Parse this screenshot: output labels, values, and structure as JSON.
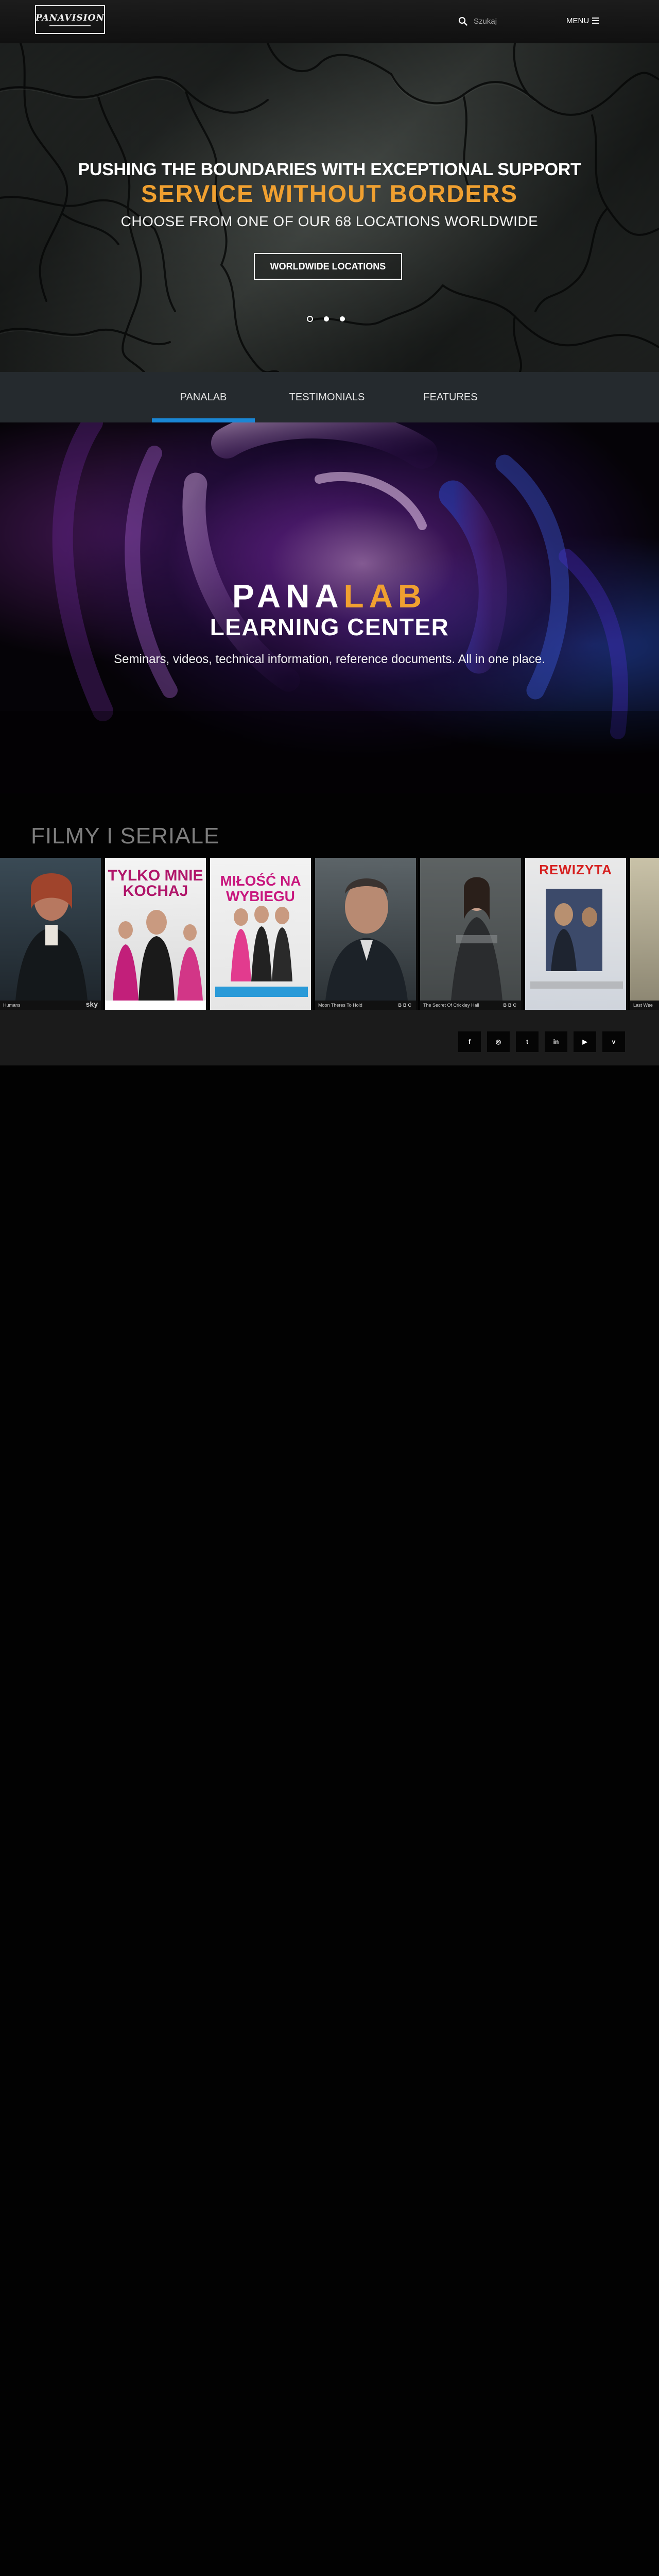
{
  "header": {
    "logo_text": "PANAVISION",
    "search_placeholder": "Szukaj",
    "menu_label": "MENU"
  },
  "hero": {
    "line1": "PUSHING THE BOUNDARIES WITH EXCEPTIONAL SUPPORT",
    "line2": "SERVICE WITHOUT BORDERS",
    "line3": "CHOOSE FROM ONE OF OUR 68 LOCATIONS WORLDWIDE",
    "button": "WORLDWIDE LOCATIONS",
    "slides": 3,
    "active_slide": 1
  },
  "tabs": [
    {
      "label": "PANALAB",
      "active": true
    },
    {
      "label": "TESTIMONIALS",
      "active": false
    },
    {
      "label": "FEATURES",
      "active": false
    }
  ],
  "learning_center": {
    "title_part1": "PANA",
    "title_part2": "LAB",
    "subtitle": "LEARNING CENTER",
    "description": "Seminars, videos, technical information, reference documents. All in one place."
  },
  "films": {
    "title": "FILMY I SERIALE",
    "posters": [
      {
        "title": "",
        "caption": "Humans",
        "badge": "sky"
      },
      {
        "title": "TYLKO MNIE KOCHAJ",
        "caption": "",
        "badge": ""
      },
      {
        "title": "MIŁOŚĆ NA WYBIEGU",
        "caption": "",
        "badge": ""
      },
      {
        "title": "",
        "caption": "Moon Theres To Hold",
        "badge": "BBC"
      },
      {
        "title": "",
        "caption": "The Secret Of Crickley Hall",
        "badge": "BBC"
      },
      {
        "title": "REWIZYTA",
        "caption": "",
        "badge": ""
      },
      {
        "title": "",
        "caption": "Last Wee",
        "badge": ""
      }
    ]
  },
  "social": [
    {
      "icon": "facebook-icon",
      "glyph": "f"
    },
    {
      "icon": "instagram-icon",
      "glyph": "◎"
    },
    {
      "icon": "twitter-icon",
      "glyph": "t"
    },
    {
      "icon": "linkedin-icon",
      "glyph": "in"
    },
    {
      "icon": "youtube-icon",
      "glyph": "▶"
    },
    {
      "icon": "vimeo-icon",
      "glyph": "v"
    }
  ],
  "colors": {
    "accent": "#f0a030",
    "tab_active": "#1a86d4",
    "tabs_bg": "#252a2e"
  }
}
